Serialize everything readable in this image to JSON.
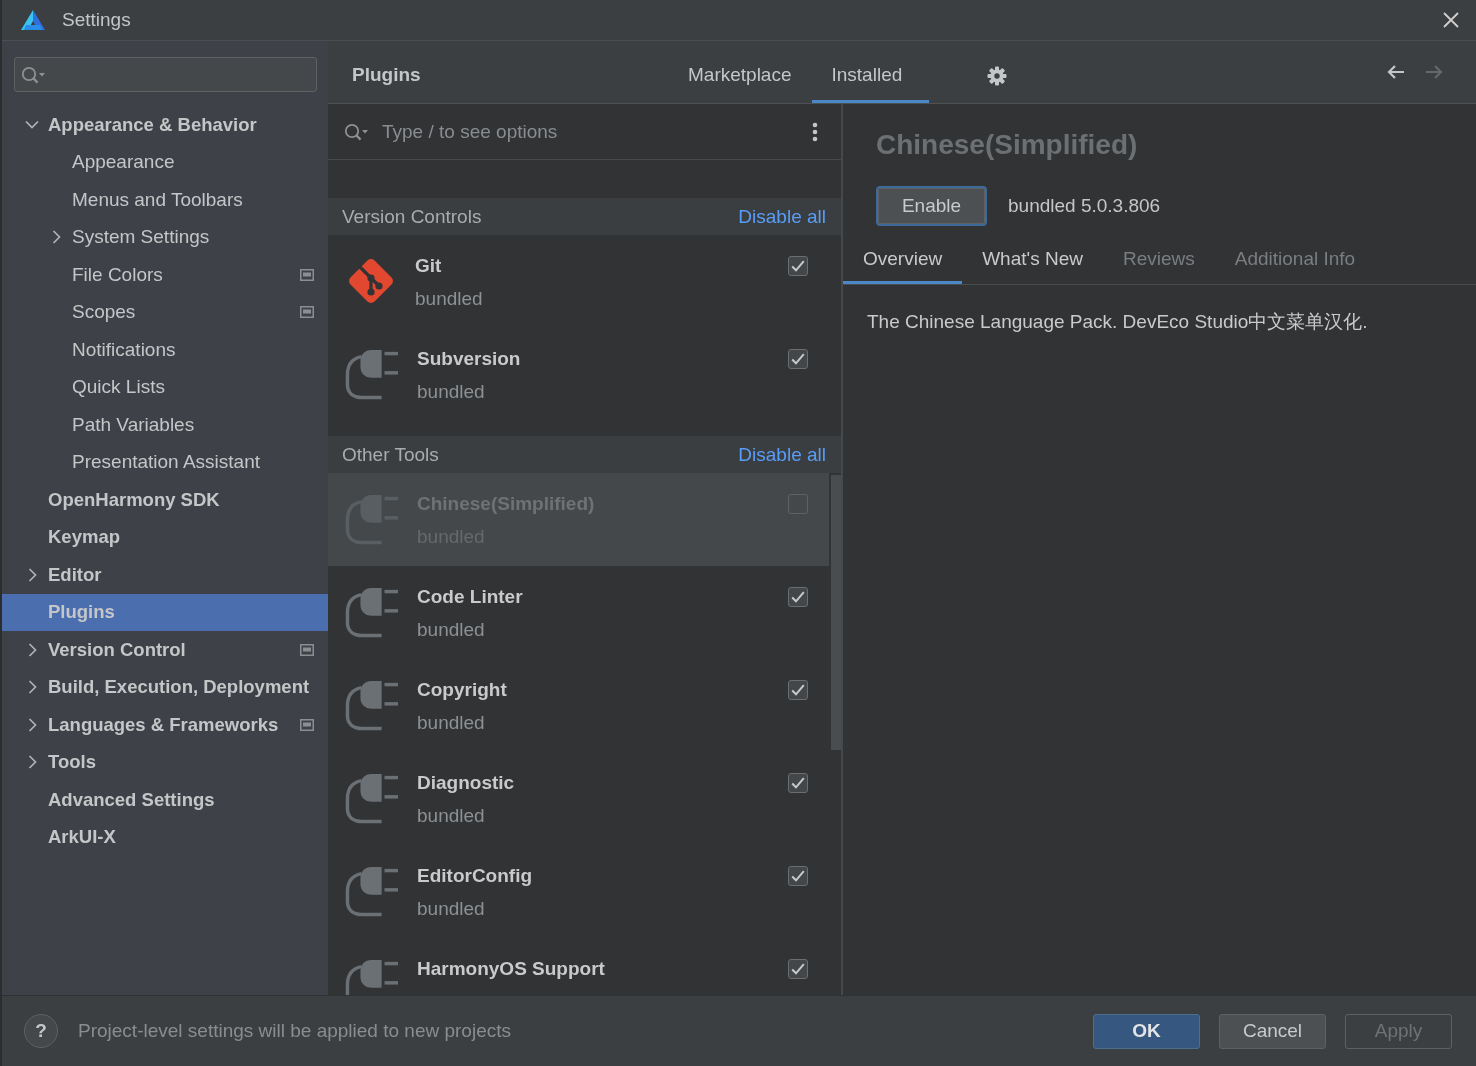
{
  "window": {
    "title": "Settings"
  },
  "sidebar": {
    "items": [
      {
        "label": "Appearance & Behavior",
        "expanded": true,
        "selected": false,
        "project_level": false,
        "children": [
          {
            "label": "Appearance",
            "selected": false,
            "project_level": false
          },
          {
            "label": "Menus and Toolbars",
            "selected": false,
            "project_level": false
          },
          {
            "label": "System Settings",
            "expanded": false,
            "selected": false,
            "project_level": false
          },
          {
            "label": "File Colors",
            "selected": false,
            "project_level": true
          },
          {
            "label": "Scopes",
            "selected": false,
            "project_level": true
          },
          {
            "label": "Notifications",
            "selected": false,
            "project_level": false
          },
          {
            "label": "Quick Lists",
            "selected": false,
            "project_level": false
          },
          {
            "label": "Path Variables",
            "selected": false,
            "project_level": false
          },
          {
            "label": "Presentation Assistant",
            "selected": false,
            "project_level": false
          }
        ]
      },
      {
        "label": "OpenHarmony SDK",
        "selected": false,
        "project_level": false
      },
      {
        "label": "Keymap",
        "selected": false,
        "project_level": false
      },
      {
        "label": "Editor",
        "expanded": false,
        "selected": false,
        "project_level": false
      },
      {
        "label": "Plugins",
        "selected": true,
        "project_level": false
      },
      {
        "label": "Version Control",
        "expanded": false,
        "selected": false,
        "project_level": true
      },
      {
        "label": "Build, Execution, Deployment",
        "expanded": false,
        "selected": false,
        "project_level": false
      },
      {
        "label": "Languages & Frameworks",
        "expanded": false,
        "selected": false,
        "project_level": true
      },
      {
        "label": "Tools",
        "expanded": false,
        "selected": false,
        "project_level": false
      },
      {
        "label": "Advanced Settings",
        "selected": false,
        "project_level": false
      },
      {
        "label": "ArkUI-X",
        "selected": false,
        "project_level": false
      }
    ]
  },
  "header": {
    "title": "Plugins",
    "tabs": [
      {
        "label": "Marketplace",
        "selected": false
      },
      {
        "label": "Installed",
        "selected": true
      }
    ],
    "nav": [
      {
        "kind": "back",
        "disabled": false
      },
      {
        "kind": "forward",
        "disabled": true
      }
    ]
  },
  "plugin_list": {
    "search": {
      "placeholder": "Type / to see options"
    },
    "groups": [
      {
        "title": "Version Controls",
        "action": "Disable all",
        "plugins": [
          {
            "name": "Git",
            "kind": "git",
            "source": "bundled",
            "checked": true,
            "selected": false,
            "disabled": false
          },
          {
            "name": "Subversion",
            "kind": "plugin",
            "source": "bundled",
            "checked": true,
            "selected": false,
            "disabled": false
          }
        ]
      },
      {
        "title": "Other Tools",
        "action": "Disable all",
        "plugins": [
          {
            "name": "Chinese(Simplified)",
            "kind": "plugin",
            "source": "bundled",
            "checked": false,
            "selected": true,
            "disabled": true
          },
          {
            "name": "Code Linter",
            "kind": "plugin",
            "source": "bundled",
            "checked": true,
            "selected": false,
            "disabled": false
          },
          {
            "name": "Copyright",
            "kind": "plugin",
            "source": "bundled",
            "checked": true,
            "selected": false,
            "disabled": false
          },
          {
            "name": "Diagnostic",
            "kind": "plugin",
            "source": "bundled",
            "checked": true,
            "selected": false,
            "disabled": false
          },
          {
            "name": "EditorConfig",
            "kind": "plugin",
            "source": "bundled",
            "checked": true,
            "selected": false,
            "disabled": false
          },
          {
            "name": "HarmonyOS Support",
            "kind": "plugin",
            "checked": true,
            "selected": false,
            "disabled": false
          }
        ]
      }
    ]
  },
  "detail": {
    "title": "Chinese(Simplified)",
    "enabled": false,
    "button": "Enable",
    "version": "bundled 5.0.3.806",
    "tabs": [
      {
        "label": "Overview",
        "selected": true,
        "disabled": false
      },
      {
        "label": "What's New",
        "selected": false,
        "disabled": false
      },
      {
        "label": "Reviews",
        "selected": false,
        "disabled": true
      },
      {
        "label": "Additional Info",
        "selected": false,
        "disabled": true
      }
    ],
    "description": "The Chinese Language Pack. DevEco Studio中文菜单汉化."
  },
  "footer": {
    "help": "?",
    "hint": "Project-level settings will be applied to new projects",
    "buttons": [
      {
        "label": "OK",
        "kind": "default",
        "disabled": false
      },
      {
        "label": "Cancel",
        "kind": "normal",
        "disabled": false
      },
      {
        "label": "Apply",
        "kind": "normal",
        "disabled": true
      }
    ]
  }
}
